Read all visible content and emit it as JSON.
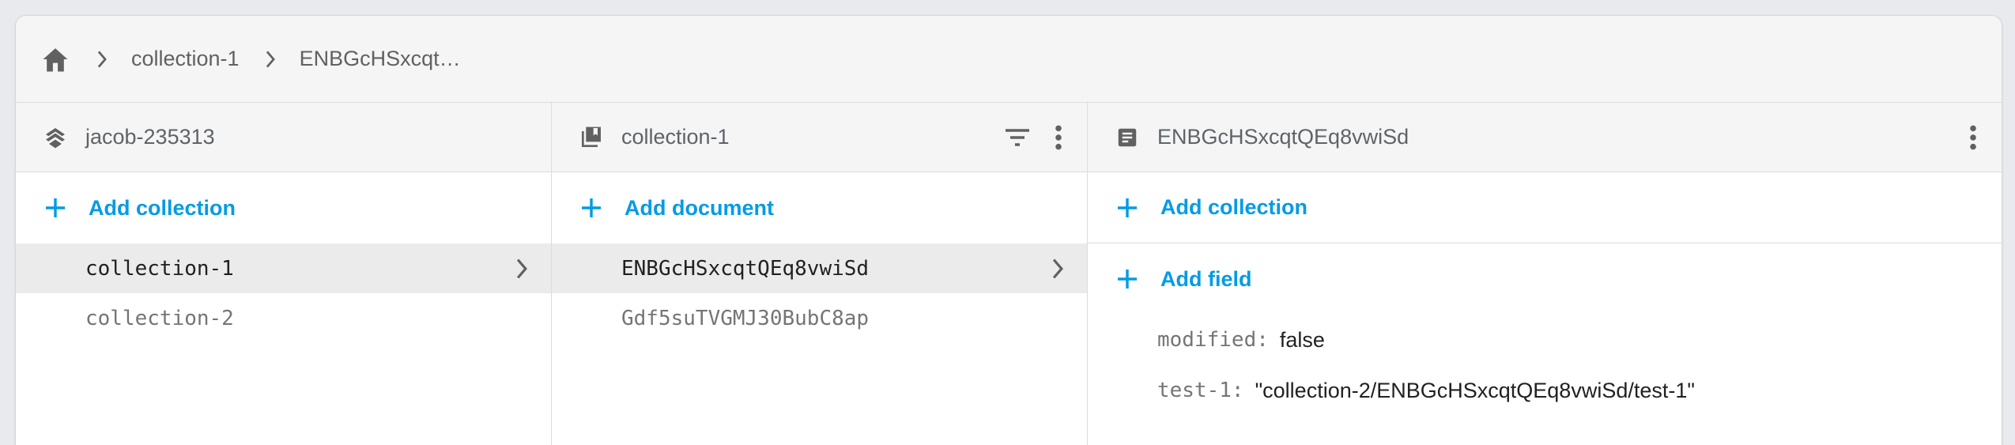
{
  "breadcrumb": {
    "home_icon": "home-icon",
    "items": [
      "collection-1",
      "ENBGcHSxcqtQEq8vwiSd"
    ]
  },
  "columns": {
    "root": {
      "icon": "firestore-layers-icon",
      "title": "jacob-235313",
      "add_label": "Add collection",
      "items": [
        "collection-1",
        "collection-2"
      ],
      "selected_index": 0
    },
    "collection": {
      "icon": "collection-icon",
      "title": "collection-1",
      "add_label": "Add document",
      "items": [
        "ENBGcHSxcqtQEq8vwiSd",
        "Gdf5suTVGMJ30BubC8ap"
      ],
      "selected_index": 0
    },
    "document": {
      "icon": "document-icon",
      "title": "ENBGcHSxcqtQEq8vwiSd",
      "add_collection_label": "Add collection",
      "add_field_label": "Add field",
      "fields": [
        {
          "key": "modified",
          "value": "false"
        },
        {
          "key": "test-1",
          "value": "\"collection-2/ENBGcHSxcqtQEq8vwiSd/test-1\""
        }
      ]
    }
  },
  "colors": {
    "accent": "#039be5",
    "header_bg": "#f5f5f5",
    "selected_bg": "#ebebeb",
    "page_bg": "#e9eaed"
  }
}
